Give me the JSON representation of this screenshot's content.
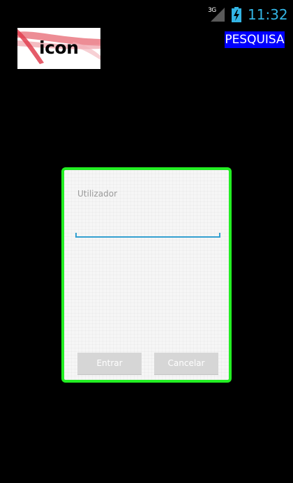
{
  "status_bar": {
    "network_type": "3G",
    "time": "11:32",
    "icons": [
      "signal-icon",
      "battery-charging-icon"
    ],
    "clock_color": "#33b5e5"
  },
  "header": {
    "logo_text": "icon",
    "search_label": "PESQUISA",
    "search_bg_color": "#0000ff"
  },
  "login_dialog": {
    "border_color": "#22ee22",
    "user_label": "Utilizador",
    "user_value": "",
    "enter_label": "Entrar",
    "cancel_label": "Cancelar"
  }
}
